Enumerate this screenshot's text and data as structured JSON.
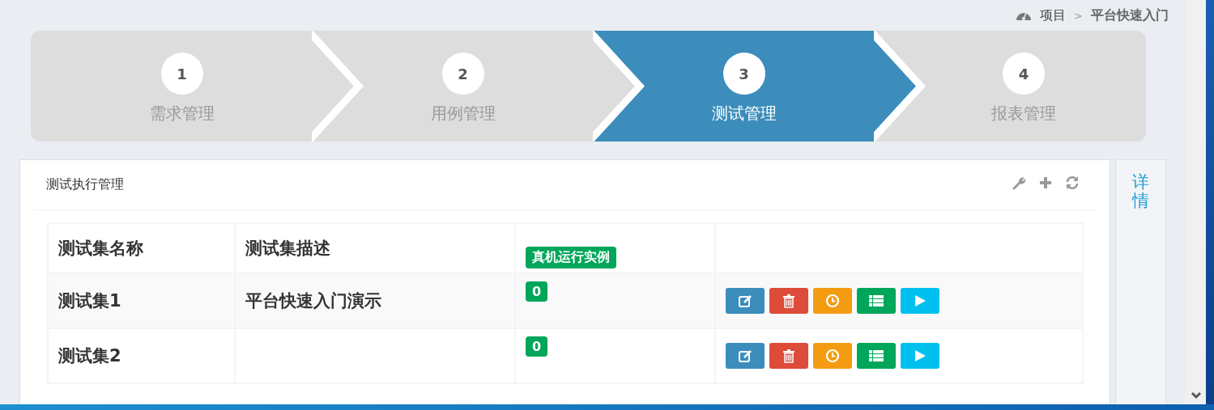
{
  "breadcrumb": {
    "items": [
      {
        "label": "项目",
        "current": false
      },
      {
        "label": "平台快速入门",
        "current": true
      }
    ],
    "separator": ">"
  },
  "wizard": {
    "steps": [
      {
        "number": "1",
        "label": "需求管理",
        "selected": false
      },
      {
        "number": "2",
        "label": "用例管理",
        "selected": false
      },
      {
        "number": "3",
        "label": "测试管理",
        "selected": true
      },
      {
        "number": "4",
        "label": "报表管理",
        "selected": false
      }
    ]
  },
  "panel": {
    "title": "测试执行管理",
    "tools": [
      {
        "kind": "settings"
      },
      {
        "kind": "add"
      },
      {
        "kind": "refresh"
      }
    ],
    "table": {
      "columns": [
        {
          "kind": "text",
          "label": "测试集名称"
        },
        {
          "kind": "text",
          "label": "测试集描述"
        },
        {
          "kind": "badge",
          "label": "真机运行实例"
        },
        {
          "kind": "empty"
        }
      ],
      "rows": [
        {
          "name": "测试集1",
          "description": "平台快速入门演示",
          "count": "0",
          "actions": [
            {
              "kind": "edit"
            },
            {
              "kind": "delete"
            },
            {
              "kind": "schedule"
            },
            {
              "kind": "list"
            },
            {
              "kind": "run"
            }
          ]
        },
        {
          "name": "测试集2",
          "count": "0",
          "actions": [
            {
              "kind": "edit"
            },
            {
              "kind": "delete"
            },
            {
              "kind": "schedule"
            },
            {
              "kind": "list"
            },
            {
              "kind": "run"
            }
          ]
        }
      ]
    }
  },
  "side_tab": {
    "label": "详情"
  }
}
